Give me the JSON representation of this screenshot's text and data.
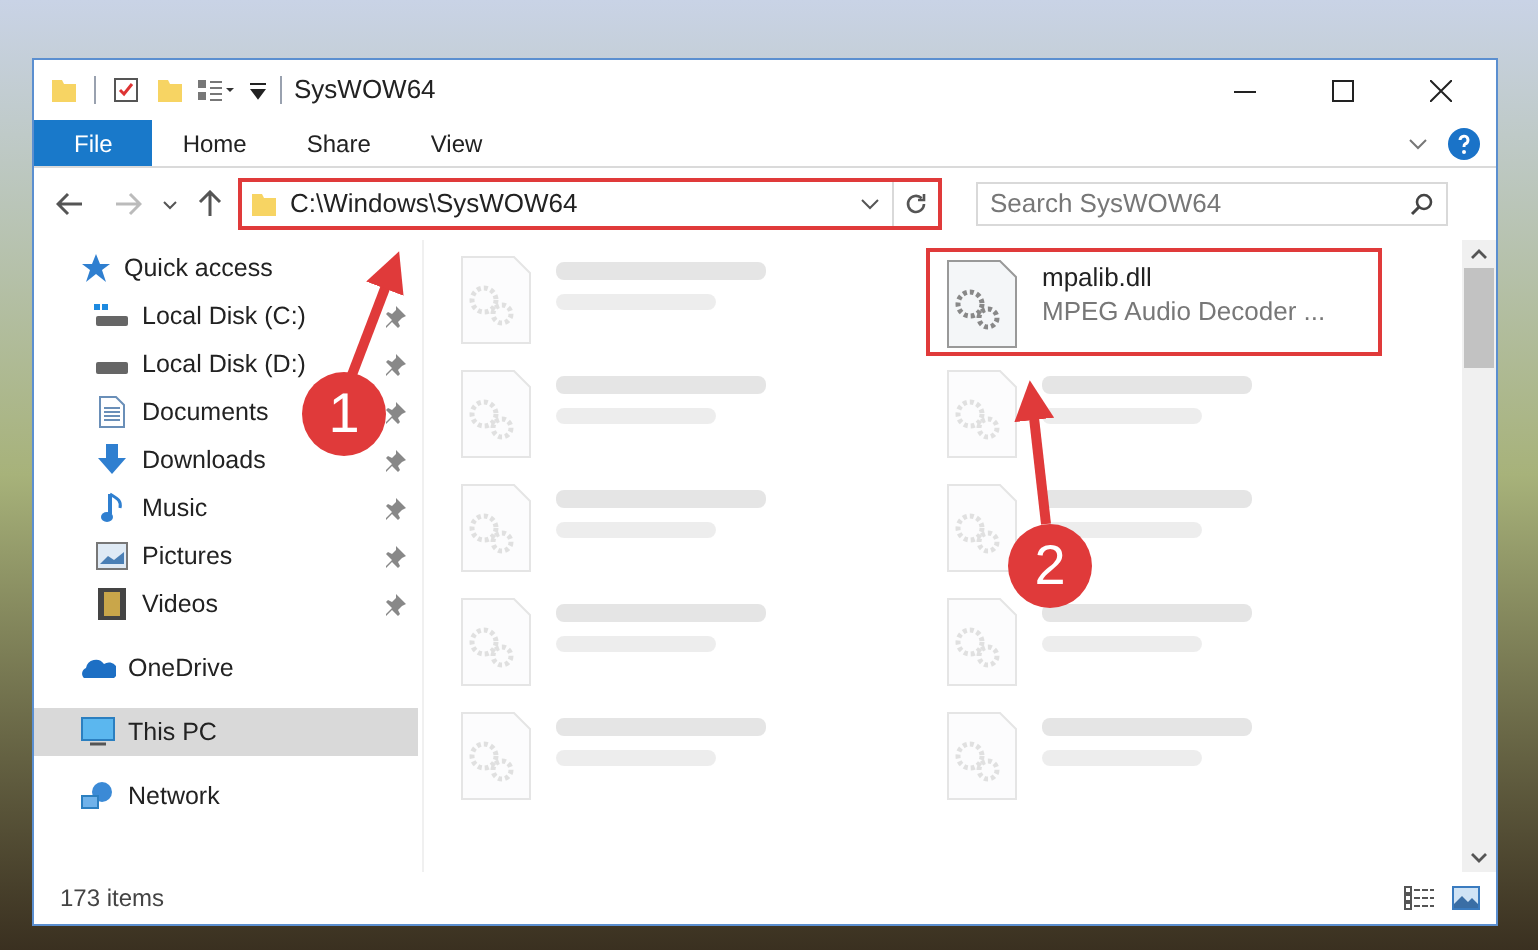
{
  "window": {
    "title": "SysWOW64"
  },
  "ribbon_tabs": [
    {
      "label": "File",
      "selected": true
    },
    {
      "label": "Home",
      "selected": false
    },
    {
      "label": "Share",
      "selected": false
    },
    {
      "label": "View",
      "selected": false
    }
  ],
  "address_bar": {
    "path": "C:\\Windows\\SysWOW64",
    "highlighted": true
  },
  "search": {
    "placeholder": "Search SysWOW64"
  },
  "sidebar": {
    "items": [
      {
        "label": "Quick access",
        "selected": false,
        "children": [
          {
            "label": "Local Disk (C:)",
            "pinned": true
          },
          {
            "label": "Local Disk (D:)",
            "pinned": true
          },
          {
            "label": "Documents",
            "pinned": true
          },
          {
            "label": "Downloads",
            "pinned": true
          },
          {
            "label": "Music",
            "pinned": true
          },
          {
            "label": "Pictures",
            "pinned": true
          },
          {
            "label": "Videos",
            "pinned": true
          }
        ]
      },
      {
        "label": "OneDrive",
        "selected": false
      },
      {
        "label": "This PC",
        "selected": true
      },
      {
        "label": "Network",
        "selected": false
      }
    ]
  },
  "files": [
    {
      "kind": "blurred"
    },
    {
      "kind": "file",
      "name": "mpalib.dll",
      "type": "MPEG Audio Decoder ...",
      "highlighted": true
    },
    {
      "kind": "blurred"
    },
    {
      "kind": "blurred"
    },
    {
      "kind": "blurred"
    },
    {
      "kind": "blurred"
    },
    {
      "kind": "blurred"
    },
    {
      "kind": "blurred"
    },
    {
      "kind": "blurred"
    },
    {
      "kind": "blurred"
    }
  ],
  "status_bar": {
    "item_count": "173 items"
  },
  "callouts": [
    {
      "number": "1"
    },
    {
      "number": "2"
    }
  ]
}
